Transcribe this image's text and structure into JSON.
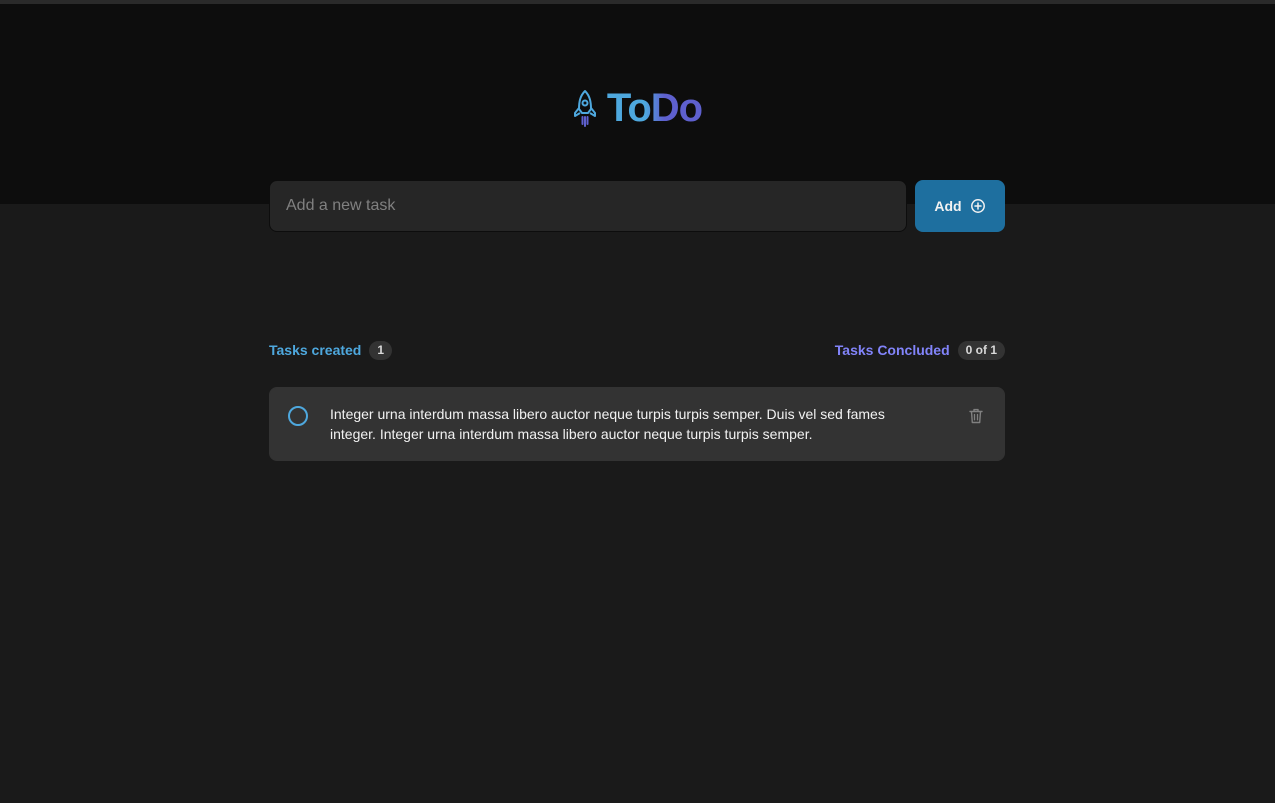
{
  "app": {
    "logo_icon": "rocket-icon",
    "title_part1": "To",
    "title_part2": "Do",
    "colors": {
      "blue": "#4ea8de",
      "purple": "#5e60ce",
      "purple_light": "#8284fa",
      "button": "#1e6f9f"
    }
  },
  "form": {
    "placeholder": "Add a new task",
    "value": "",
    "add_label": "Add",
    "add_icon": "plus-circle-icon"
  },
  "counters": {
    "created_label": "Tasks created",
    "created_count": "1",
    "concluded_label": "Tasks Concluded",
    "concluded_count": "0 of 1"
  },
  "tasks": [
    {
      "text": "Integer urna interdum massa libero auctor neque turpis turpis semper. Duis vel sed fames integer. Integer urna interdum massa libero auctor neque turpis turpis semper.",
      "completed": false,
      "check_icon": "circle-icon",
      "delete_icon": "trash-icon"
    }
  ]
}
